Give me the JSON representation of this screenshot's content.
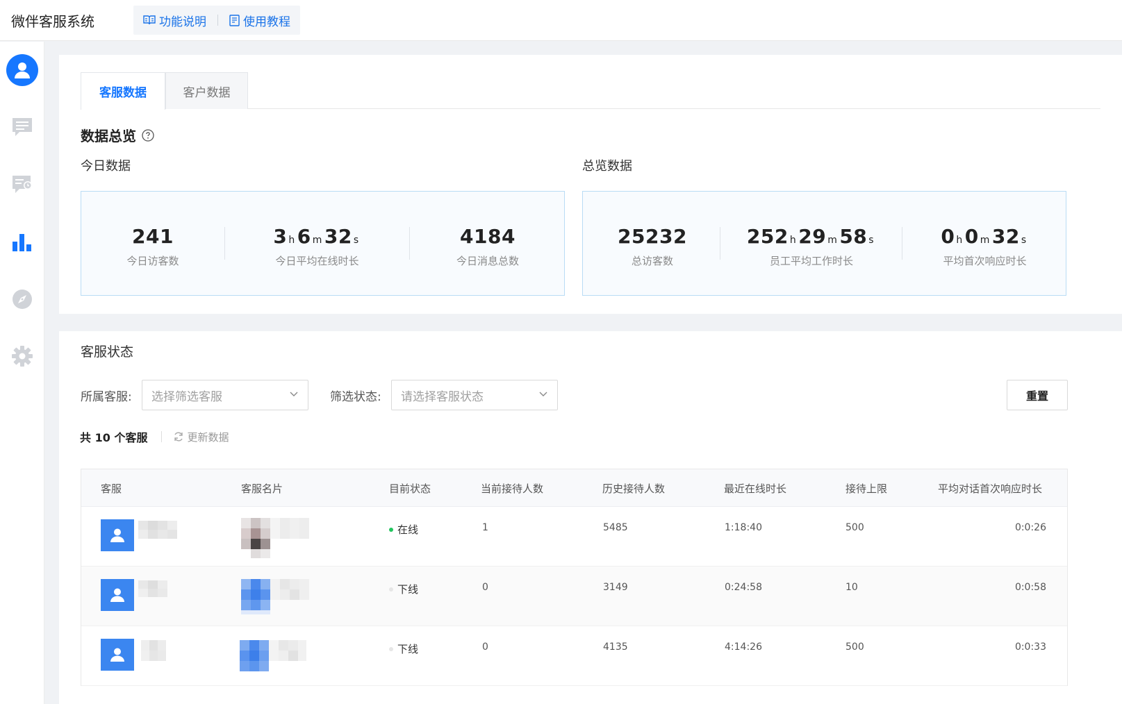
{
  "app": {
    "title": "微伴客服系统",
    "links": [
      {
        "label": "功能说明",
        "icon": "book-icon"
      },
      {
        "label": "使用教程",
        "icon": "document-icon"
      }
    ]
  },
  "sidebar": {
    "items": [
      {
        "icon": "user-icon",
        "active": true
      },
      {
        "icon": "chat-icon"
      },
      {
        "icon": "chat-clock-icon"
      },
      {
        "icon": "bar-chart-icon",
        "active": true
      },
      {
        "icon": "compass-icon"
      },
      {
        "icon": "gear-icon"
      }
    ]
  },
  "tabs": [
    {
      "label": "客服数据",
      "active": true
    },
    {
      "label": "客户数据",
      "active": false
    }
  ],
  "overview": {
    "title": "数据总览",
    "today": {
      "title": "今日数据",
      "stats": [
        {
          "value": "241",
          "label": "今日访客数"
        },
        {
          "h": "3",
          "m": "6",
          "s": "32",
          "label": "今日平均在线时长"
        },
        {
          "value": "4184",
          "label": "今日消息总数"
        }
      ]
    },
    "total": {
      "title": "总览数据",
      "stats": [
        {
          "value": "25232",
          "label": "总访客数"
        },
        {
          "h": "252",
          "m": "29",
          "s": "58",
          "label": "员工平均工作时长"
        },
        {
          "h": "0",
          "m": "0",
          "s": "32",
          "label": "平均首次响应时长"
        }
      ]
    },
    "units": {
      "h": "h",
      "m": "m",
      "s": "s"
    }
  },
  "status_section": {
    "title": "客服状态",
    "filters": {
      "agent_label": "所属客服:",
      "agent_placeholder": "选择筛选客服",
      "status_label": "筛选状态:",
      "status_placeholder": "请选择客服状态"
    },
    "reset_label": "重置",
    "count": {
      "prefix": "共",
      "number": "10",
      "suffix": "个客服"
    },
    "refresh_label": "更新数据"
  },
  "table": {
    "columns": [
      "客服",
      "客服名片",
      "目前状态",
      "当前接待人数",
      "历史接待人数",
      "最近在线时长",
      "接待上限",
      "平均对话首次响应时长"
    ],
    "rows": [
      {
        "status": "在线",
        "online": true,
        "current": "1",
        "history": "5485",
        "recent": "1:18:40",
        "limit": "500",
        "avg_first": "0:0:26"
      },
      {
        "status": "下线",
        "online": false,
        "current": "0",
        "history": "3149",
        "recent": "0:24:58",
        "limit": "10",
        "avg_first": "0:0:58"
      },
      {
        "status": "下线",
        "online": false,
        "current": "0",
        "history": "4135",
        "recent": "4:14:26",
        "limit": "500",
        "avg_first": "0:0:33"
      }
    ]
  },
  "colors": {
    "accent": "#1677ff",
    "online": "#22c55e",
    "offline": "#e0e0e0"
  }
}
